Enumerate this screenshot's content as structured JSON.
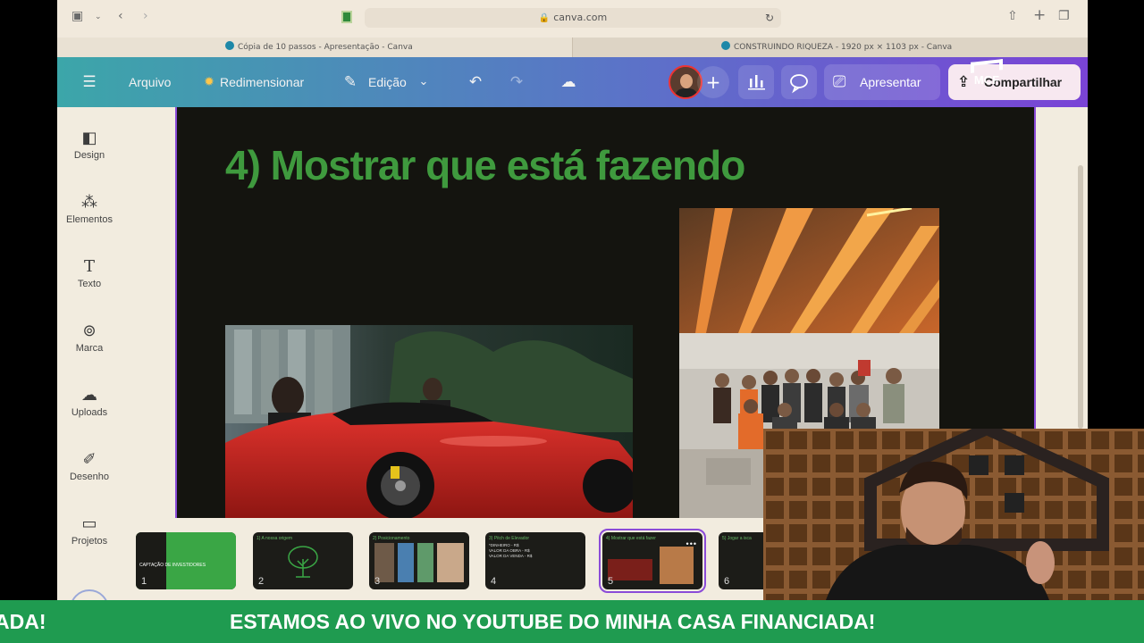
{
  "browser": {
    "url": "canva.com",
    "tabs": [
      "Cópia de 10 passos - Apresentação - Canva",
      "CONSTRUINDO RIQUEZA - 1920 px × 1103 px - Canva"
    ]
  },
  "toolbar": {
    "menu_label": "Arquivo",
    "resize_label": "Redimensionar",
    "edit_label": "Edição",
    "present_label": "Apresentar",
    "share_label": "Compartilhar"
  },
  "watermark": "MCF",
  "sidebar": {
    "items": [
      {
        "label": "Design",
        "icon": "layout-icon"
      },
      {
        "label": "Elementos",
        "icon": "shapes-icon"
      },
      {
        "label": "Texto",
        "icon": "text-icon"
      },
      {
        "label": "Marca",
        "icon": "brand-icon"
      },
      {
        "label": "Uploads",
        "icon": "cloud-upload-icon"
      },
      {
        "label": "Desenho",
        "icon": "pen-icon"
      },
      {
        "label": "Projetos",
        "icon": "folder-icon"
      }
    ]
  },
  "slide": {
    "title": "4) Mostrar que está fazendo"
  },
  "thumbnails": [
    {
      "number": "1",
      "title": "CAPTAÇÃO DE INVESTIDORES"
    },
    {
      "number": "2",
      "title": "1) A nossa origem"
    },
    {
      "number": "3",
      "title": "2) Posicionamento"
    },
    {
      "number": "4",
      "title": "3) Pitch de Elevador",
      "lines": [
        "*DINHEIRO - R$",
        "VALOR DA OBRA - R$",
        "VALOR DA VENDA - R$"
      ]
    },
    {
      "number": "5",
      "title": "4) Mostrar que está fazer"
    },
    {
      "number": "6",
      "title": "5) Jogar a isca"
    }
  ],
  "banner": {
    "partial_text": "ADA!",
    "text": "ESTAMOS AO VIVO NO YOUTUBE DO MINHA CASA FINANCIADA!"
  },
  "colors": {
    "slide_title": "#3f9a3e",
    "banner": "#1f9b50",
    "canva_gradient_start": "#3ca6a9",
    "canva_gradient_end": "#7a43d6",
    "active_thumb_outline": "#8b4bd8"
  }
}
